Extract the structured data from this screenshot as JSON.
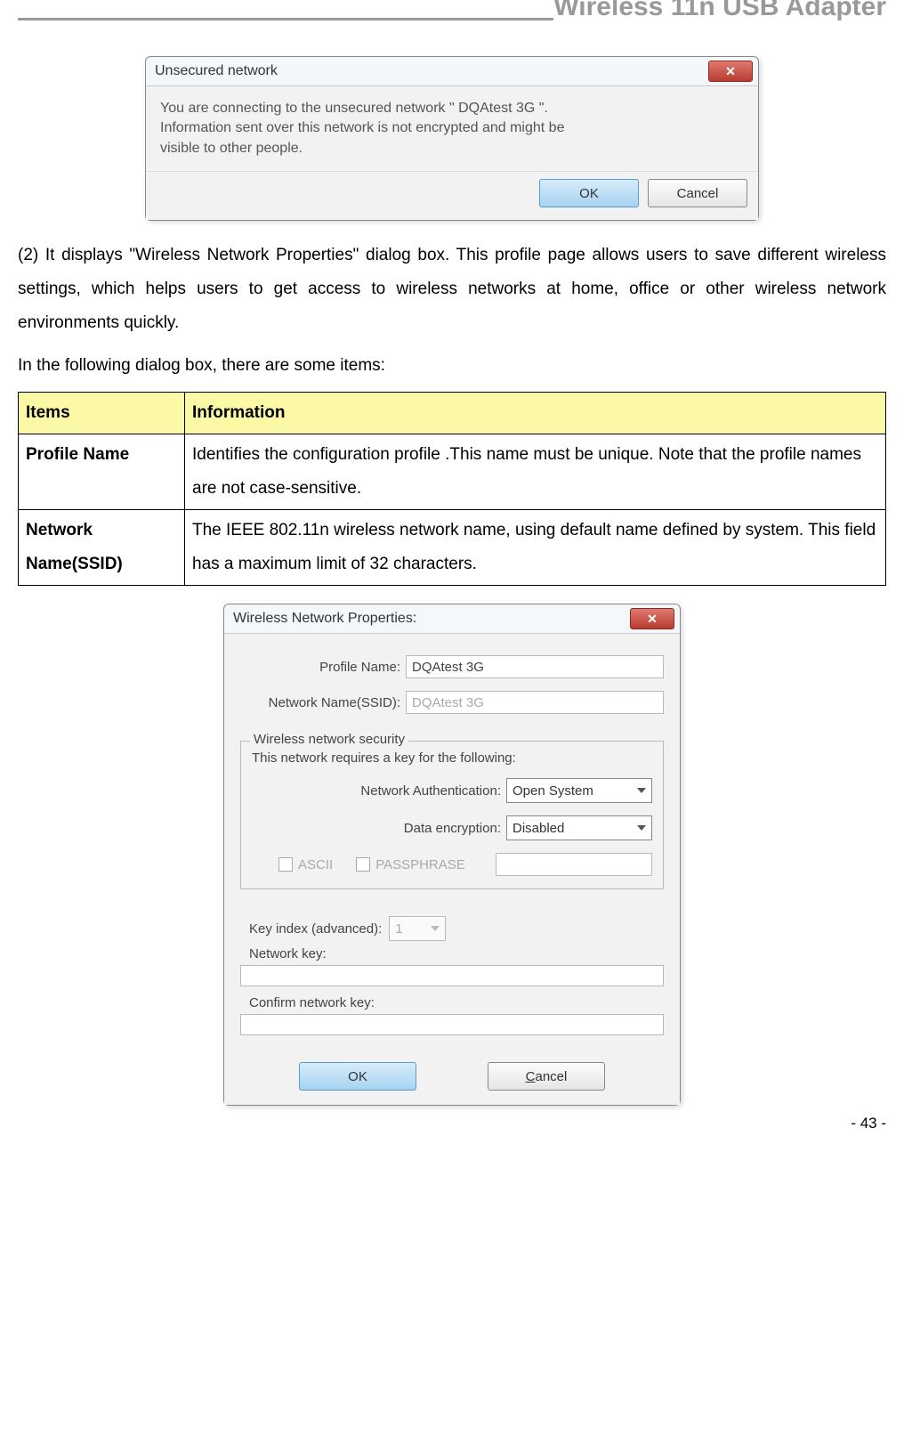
{
  "header": {
    "title": "Wireless 11n USB Adapter"
  },
  "dialog1": {
    "title": "Unsecured network",
    "message_line1": "You are connecting to the unsecured network \" DQAtest  3G \".",
    "message_line2": "Information sent over this network is not encrypted and might be",
    "message_line3": "visible to other people.",
    "ok": "OK",
    "cancel": "Cancel"
  },
  "paragraph1": "(2) It displays \"Wireless Network Properties\" dialog box. This profile page allows users to save different wireless settings, which helps users to get access to wireless networks at home, office or other wireless network environments quickly.",
  "paragraph2": "In the following dialog box, there are some items:",
  "table": {
    "header_items": "Items",
    "header_info": "Information",
    "rows": [
      {
        "item": "Profile Name",
        "info": "Identifies the configuration profile .This name must be unique. Note that the profile names are not case-sensitive."
      },
      {
        "item": "Network Name(SSID)",
        "info": "The IEEE 802.11n wireless network name, using default name defined by system. This field has a maximum limit of 32 characters."
      }
    ]
  },
  "dialog2": {
    "title": "Wireless Network Properties:",
    "profile_name_label": "Profile Name:",
    "profile_name_value": "DQAtest  3G",
    "ssid_label": "Network Name(SSID):",
    "ssid_value": "DQAtest 3G",
    "security_legend": "Wireless network security",
    "security_text": "This network requires a key for the following:",
    "net_auth_label": "Network Authentication:",
    "net_auth_value": "Open System",
    "data_enc_label": "Data encryption:",
    "data_enc_value": "Disabled",
    "ascii_label": "ASCII",
    "passphrase_label": "PASSPHRASE",
    "key_index_label": "Key index (advanced):",
    "key_index_value": "1",
    "net_key_label": "Network key:",
    "confirm_key_label": "Confirm network key:",
    "ok": "OK",
    "cancel": "Cancel",
    "cancel_rest": "ancel"
  },
  "page_number": "- 43 -"
}
